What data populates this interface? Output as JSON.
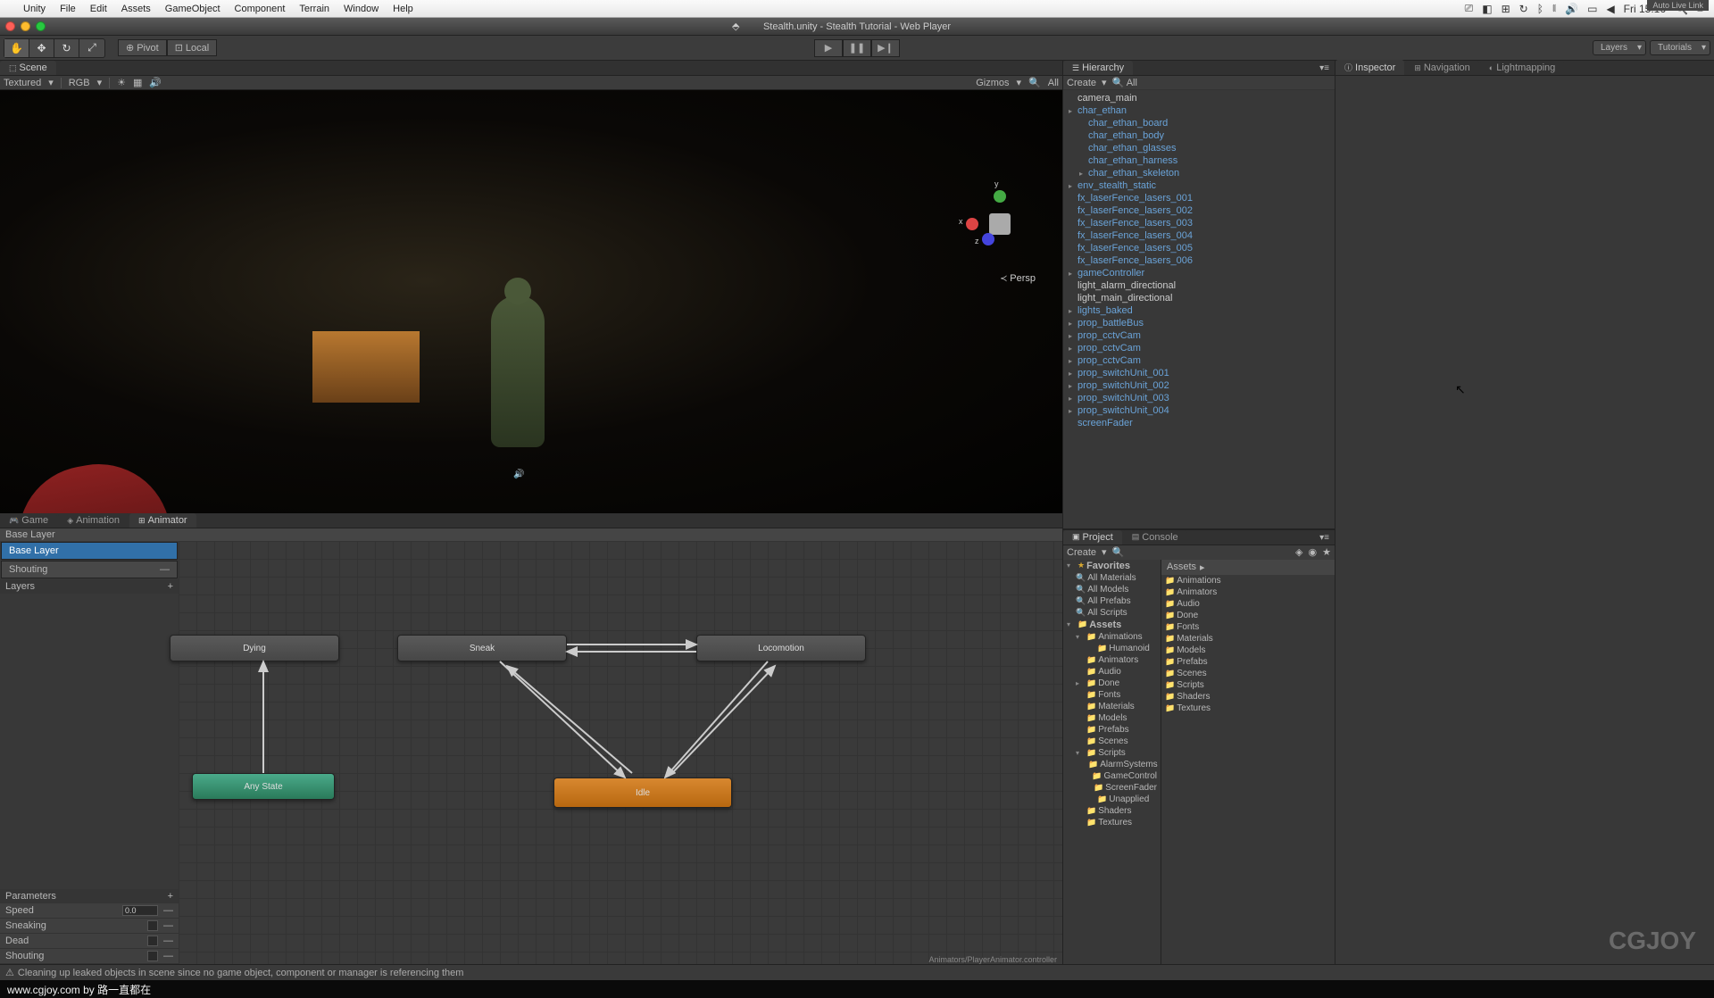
{
  "mac_menu": {
    "items": [
      "Unity",
      "File",
      "Edit",
      "Assets",
      "GameObject",
      "Component",
      "Terrain",
      "Window",
      "Help"
    ],
    "clock": "Fri 15:16"
  },
  "window_title": "Stealth.unity - Stealth Tutorial - Web Player",
  "toolbar": {
    "pivot": "Pivot",
    "local": "Local",
    "layers": "Layers",
    "tutorials": "Tutorials"
  },
  "scene_tab": "Scene",
  "scene_bar": {
    "shaded": "Textured",
    "rgb": "RGB",
    "gizmos": "Gizmos",
    "all": "All"
  },
  "scene": {
    "persp": "Persp",
    "axes": {
      "x": "x",
      "y": "y",
      "z": "z"
    }
  },
  "lower_tabs": {
    "game": "Game",
    "animation": "Animation",
    "animator": "Animator"
  },
  "animator": {
    "breadcrumb": "Base Layer",
    "auto_live": "Auto Live Link",
    "layers_header": "Layers",
    "layers": [
      {
        "name": "Base Layer"
      },
      {
        "name": "Shouting"
      }
    ],
    "params_header": "Parameters",
    "params": [
      {
        "name": "Speed",
        "value": "0.0",
        "type": "float"
      },
      {
        "name": "Sneaking",
        "type": "bool"
      },
      {
        "name": "Dead",
        "type": "bool"
      },
      {
        "name": "Shouting",
        "type": "bool"
      }
    ],
    "states": {
      "dying": "Dying",
      "sneak": "Sneak",
      "locomotion": "Locomotion",
      "anystate": "Any State",
      "idle": "Idle"
    },
    "footer": "Animators/PlayerAnimator.controller"
  },
  "hierarchy": {
    "title": "Hierarchy",
    "create": "Create",
    "items": [
      {
        "name": "camera_main",
        "plain": true
      },
      {
        "name": "char_ethan",
        "exp": true
      },
      {
        "name": "char_ethan_board",
        "l": 1
      },
      {
        "name": "char_ethan_body",
        "l": 1
      },
      {
        "name": "char_ethan_glasses",
        "l": 1
      },
      {
        "name": "char_ethan_harness",
        "l": 1
      },
      {
        "name": "char_ethan_skeleton",
        "l": 1,
        "exp": false,
        "arrow": true
      },
      {
        "name": "env_stealth_static",
        "arrow": true
      },
      {
        "name": "fx_laserFence_lasers_001"
      },
      {
        "name": "fx_laserFence_lasers_002"
      },
      {
        "name": "fx_laserFence_lasers_003"
      },
      {
        "name": "fx_laserFence_lasers_004"
      },
      {
        "name": "fx_laserFence_lasers_005"
      },
      {
        "name": "fx_laserFence_lasers_006"
      },
      {
        "name": "gameController",
        "arrow": true
      },
      {
        "name": "light_alarm_directional",
        "plain": true
      },
      {
        "name": "light_main_directional",
        "plain": true
      },
      {
        "name": "lights_baked",
        "arrow": true
      },
      {
        "name": "prop_battleBus",
        "arrow": true
      },
      {
        "name": "prop_cctvCam",
        "arrow": true
      },
      {
        "name": "prop_cctvCam",
        "arrow": true
      },
      {
        "name": "prop_cctvCam",
        "arrow": true
      },
      {
        "name": "prop_switchUnit_001",
        "arrow": true
      },
      {
        "name": "prop_switchUnit_002",
        "arrow": true
      },
      {
        "name": "prop_switchUnit_003",
        "arrow": true
      },
      {
        "name": "prop_switchUnit_004",
        "arrow": true
      },
      {
        "name": "screenFader"
      }
    ]
  },
  "project": {
    "tab_project": "Project",
    "tab_console": "Console",
    "create": "Create",
    "favorites_label": "Favorites",
    "favorites": [
      "All Materials",
      "All Models",
      "All Prefabs",
      "All Scripts"
    ],
    "assets_label": "Assets",
    "tree": [
      {
        "name": "Animations",
        "exp": true,
        "children": [
          {
            "name": "Humanoid"
          }
        ]
      },
      {
        "name": "Animators"
      },
      {
        "name": "Audio"
      },
      {
        "name": "Done",
        "arrow": true
      },
      {
        "name": "Fonts"
      },
      {
        "name": "Materials"
      },
      {
        "name": "Models"
      },
      {
        "name": "Prefabs"
      },
      {
        "name": "Scenes"
      },
      {
        "name": "Scripts",
        "exp": true,
        "children": [
          {
            "name": "AlarmSystems"
          },
          {
            "name": "GameControl"
          },
          {
            "name": "ScreenFader"
          },
          {
            "name": "Unapplied"
          }
        ]
      },
      {
        "name": "Shaders"
      },
      {
        "name": "Textures"
      }
    ],
    "assets_header": "Assets",
    "content": [
      "Animations",
      "Animators",
      "Audio",
      "Done",
      "Fonts",
      "Materials",
      "Models",
      "Prefabs",
      "Scenes",
      "Scripts",
      "Shaders",
      "Textures"
    ]
  },
  "inspector": {
    "inspector": "Inspector",
    "navigation": "Navigation",
    "lightmapping": "Lightmapping"
  },
  "status": "Cleaning up leaked objects in scene since no game object, component or manager is referencing them",
  "caption": "www.cgjoy.com by 路一直都在",
  "watermark": "CGJOY"
}
